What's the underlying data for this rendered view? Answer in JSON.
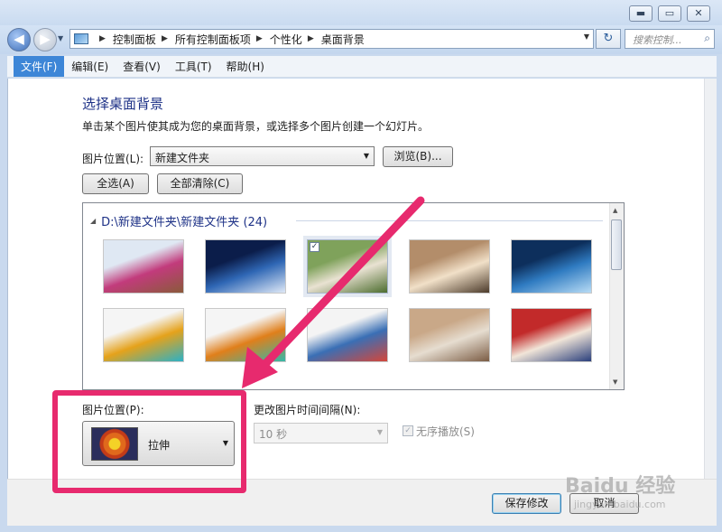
{
  "window": {
    "minimize": "▬",
    "maximize": "▭",
    "close": "✕"
  },
  "nav": {
    "back": "◀",
    "forward": "▶",
    "breadcrumbs": [
      "控制面板",
      "所有控制面板项",
      "个性化",
      "桌面背景"
    ],
    "search_placeholder": "搜索控制...",
    "refresh": "↻"
  },
  "menu": [
    "文件(F)",
    "编辑(E)",
    "查看(V)",
    "工具(T)",
    "帮助(H)"
  ],
  "page": {
    "title": "选择桌面背景",
    "description": "单击某个图片使其成为您的桌面背景，或选择多个图片创建一个幻灯片。",
    "location_label": "图片位置(L):",
    "location_value": "新建文件夹",
    "browse": "浏览(B)...",
    "select_all": "全选(A)",
    "clear_all": "全部清除(C)"
  },
  "gallery": {
    "group_title": "D:\\新建文件夹\\新建文件夹 (24)",
    "thumbnails": [
      {
        "name": "student-writing",
        "checked": false,
        "colors": [
          "#dfe8f3",
          "#c23b7c",
          "#8a5a3a"
        ]
      },
      {
        "name": "sunrise-stars",
        "checked": false,
        "colors": [
          "#0b1d4a",
          "#2f67b5",
          "#dfe9f7"
        ]
      },
      {
        "name": "students-outdoors",
        "checked": true,
        "colors": [
          "#7fa25b",
          "#e9e2d2",
          "#4c6d2e"
        ]
      },
      {
        "name": "students-classroom",
        "checked": false,
        "colors": [
          "#b38d6a",
          "#f1e0c8",
          "#4b3a2a"
        ]
      },
      {
        "name": "lab-flasks-blue",
        "checked": false,
        "colors": [
          "#0d2f5c",
          "#2f7bc1",
          "#b8dcf5"
        ]
      },
      {
        "name": "colored-flasks",
        "checked": false,
        "colors": [
          "#f5f5f5",
          "#e5a21b",
          "#2bb1c6"
        ]
      },
      {
        "name": "colored-flasks-2",
        "checked": false,
        "colors": [
          "#f5f5f5",
          "#e07f1b",
          "#34b8a8"
        ]
      },
      {
        "name": "students-group",
        "checked": false,
        "colors": [
          "#f4f4f4",
          "#3a6fb5",
          "#d4463a"
        ]
      },
      {
        "name": "lecture-hall",
        "checked": false,
        "colors": [
          "#c9a888",
          "#e6ddd0",
          "#7b5c44"
        ]
      },
      {
        "name": "flag-students",
        "checked": false,
        "colors": [
          "#c22a2a",
          "#f1e5d8",
          "#2a3f7c"
        ]
      }
    ]
  },
  "position": {
    "label": "图片位置(P):",
    "value": "拉伸"
  },
  "interval": {
    "label": "更改图片时间间隔(N):",
    "value": "10 秒"
  },
  "shuffle": {
    "label": "无序播放(S)",
    "checked": true
  },
  "buttons": {
    "save": "保存修改",
    "cancel": "取消"
  },
  "watermark": {
    "main": "Baidu 经验",
    "sub": "jingyan.baidu.com"
  },
  "colors": {
    "annotation": "#e72a6e",
    "title_blue": "#1e3287"
  }
}
